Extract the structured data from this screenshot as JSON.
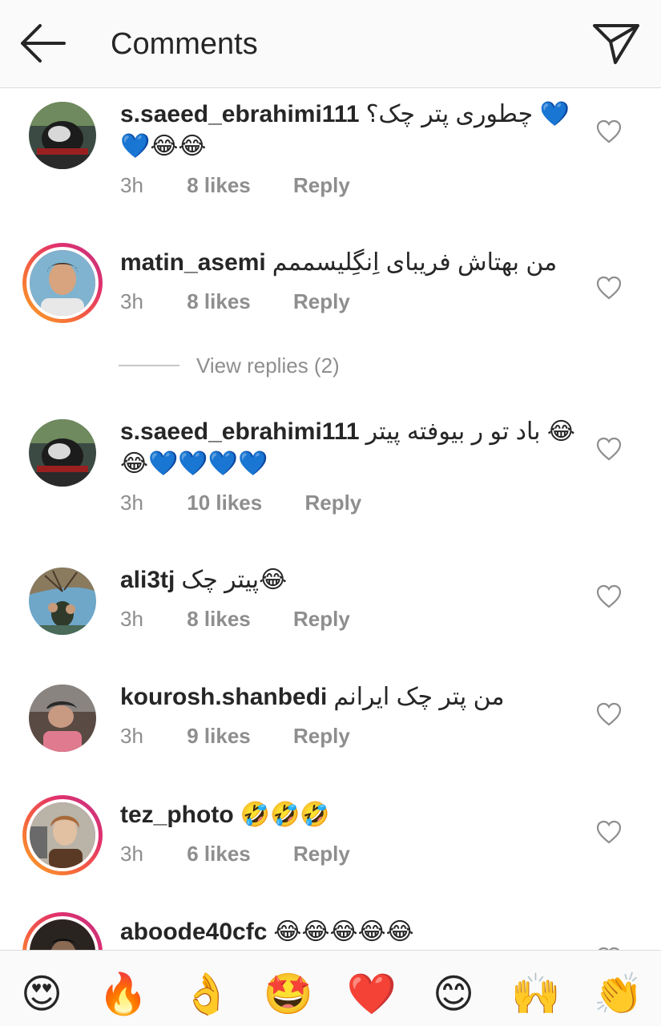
{
  "header": {
    "title": "Comments",
    "back_icon": "arrow-left-icon",
    "send_icon": "paper-plane-icon"
  },
  "comments": [
    {
      "username": "s.saeed_ebrahimi111",
      "text": "چطوری پتر چک؟ 💙💙😂😂",
      "time": "3h",
      "likes": "8 likes",
      "reply": "Reply",
      "avatar": "motorcycle-helmet-avatar",
      "story_ring": false
    },
    {
      "username": "matin_asemi",
      "text": "من بهتاش فریبای اِنگِلیسممم",
      "time": "3h",
      "likes": "8 likes",
      "reply": "Reply",
      "avatar": "young-man-portrait-avatar",
      "story_ring": true
    },
    {
      "username": "s.saeed_ebrahimi111",
      "text": "باد تو ر بیوفته پیتر 😂😂💙💙💙💙",
      "time": "3h",
      "likes": "10 likes",
      "reply": "Reply",
      "avatar": "motorcycle-helmet-avatar",
      "story_ring": false
    },
    {
      "username": "ali3tj",
      "text": "پیتر چک😂",
      "time": "3h",
      "likes": "8 likes",
      "reply": "Reply",
      "avatar": "outdoor-tree-avatar",
      "story_ring": false
    },
    {
      "username": "kourosh.shanbedi",
      "text": "من پتر چک ایرانم",
      "time": "3h",
      "likes": "9 likes",
      "reply": "Reply",
      "avatar": "car-selfie-avatar",
      "story_ring": false
    },
    {
      "username": "tez_photo",
      "text": "🤣🤣🤣",
      "time": "3h",
      "likes": "6 likes",
      "reply": "Reply",
      "avatar": "smiling-person-avatar",
      "story_ring": true
    },
    {
      "username": "aboode40cfc",
      "text": "😂😂😂😂😂",
      "avatar": "dark-portrait-avatar",
      "story_ring": true
    }
  ],
  "view_replies": "View replies (2)",
  "emoji_bar": [
    "😍",
    "🔥",
    "👌",
    "🤩",
    "❤️",
    "😊",
    "🙌",
    "👏"
  ],
  "colors": {
    "text_primary": "#262626",
    "text_secondary": "#8e8e8e",
    "header_bg": "#fafafa",
    "divider": "#dbdbdb",
    "story_ring_start": "#f9a825",
    "story_ring_end": "#c13584"
  }
}
